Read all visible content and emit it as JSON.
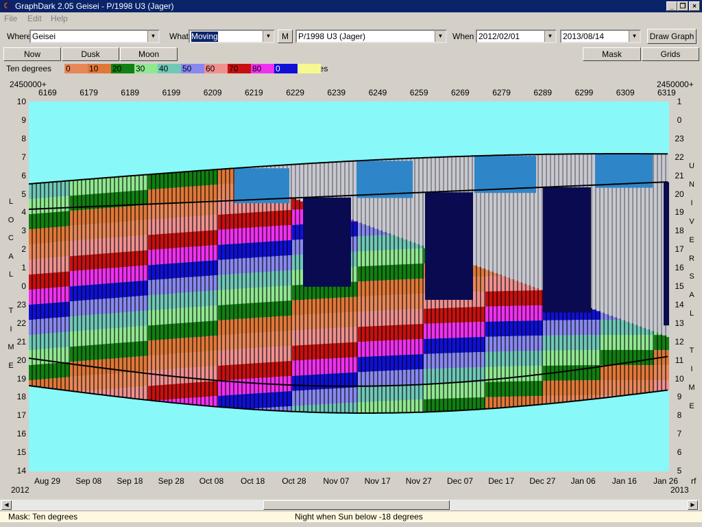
{
  "window": {
    "title": "GraphDark 2.05  Geisei  -  P/1998 U3 (Jager)",
    "minimize": "_",
    "restore": "❐",
    "close": "×"
  },
  "menu": [
    "File",
    "Edit",
    "Help"
  ],
  "toolbar": {
    "where_label": "Where",
    "where_value": "Geisei",
    "what_label": "What",
    "what_value": "Moving",
    "m_button": "M",
    "object_value": "P/1998 U3 (Jager)",
    "when_label": "When",
    "date_from": "2012/02/01",
    "date_to": "2013/08/14",
    "draw_graph": "Draw Graph"
  },
  "buttons": {
    "now": "Now",
    "dusk": "Dusk",
    "moon": "Moon",
    "mask": "Mask",
    "grids": "Grids"
  },
  "legend": {
    "label": "Ten degrees",
    "units": "Degrees",
    "items": [
      {
        "text": "0",
        "color": "#e8875a"
      },
      {
        "text": "10",
        "color": "#e07838"
      },
      {
        "text": "20",
        "color": "#128012"
      },
      {
        "text": "30",
        "color": "#90e890"
      },
      {
        "text": "40",
        "color": "#70c8b8"
      },
      {
        "text": "50",
        "color": "#8888f0"
      },
      {
        "text": "60",
        "color": "#f09090"
      },
      {
        "text": "70",
        "color": "#c81010"
      },
      {
        "text": "80",
        "color": "#f030f0"
      },
      {
        "text": "0",
        "color": "#1010d8"
      },
      {
        "text": "",
        "color": "#f8f890"
      }
    ]
  },
  "jd": {
    "prefix_left": "2450000+",
    "prefix_right": "2450000+",
    "ticks": [
      "6169",
      "6179",
      "6189",
      "6199",
      "6209",
      "6219",
      "6229",
      "6239",
      "6249",
      "6259",
      "6269",
      "6279",
      "6289",
      "6299",
      "6309",
      "6319"
    ]
  },
  "axis_left": [
    "10",
    "9",
    "8",
    "7",
    "6",
    "5",
    "4",
    "3",
    "2",
    "1",
    "0",
    "23",
    "22",
    "21",
    "20",
    "19",
    "18",
    "17",
    "16",
    "15",
    "14"
  ],
  "axis_right": [
    "1",
    "0",
    "23",
    "22",
    "21",
    "20",
    "19",
    "18",
    "17",
    "16",
    "15",
    "14",
    "13",
    "12",
    "11",
    "10",
    "9",
    "8",
    "7",
    "6",
    "5"
  ],
  "label_local": [
    "L",
    "O",
    "C",
    "A",
    "L",
    "",
    "T",
    "I",
    "M",
    "E"
  ],
  "label_universal": [
    "U",
    "N",
    "I",
    "V",
    "E",
    "R",
    "S",
    "A",
    "L",
    "",
    "T",
    "I",
    "M",
    "E"
  ],
  "dates": [
    "Aug 29",
    "Sep 08",
    "Sep 18",
    "Sep 28",
    "Oct 08",
    "Oct 18",
    "Oct 28",
    "Nov 07",
    "Nov 17",
    "Nov 27",
    "Dec 07",
    "Dec 17",
    "Dec 27",
    "Jan 06",
    "Jan 16",
    "Jan 26"
  ],
  "year_left": "2012",
  "year_right": "2013",
  "corner_right": "rf",
  "status": {
    "mask": "Mask:  Ten degrees",
    "night": "Night when Sun below -18 degrees"
  },
  "colors": {
    "sky": "#88f8f8",
    "night": "#0a0a50",
    "twilight": "#2e86c8",
    "moonlit": "#c8c8d0"
  }
}
